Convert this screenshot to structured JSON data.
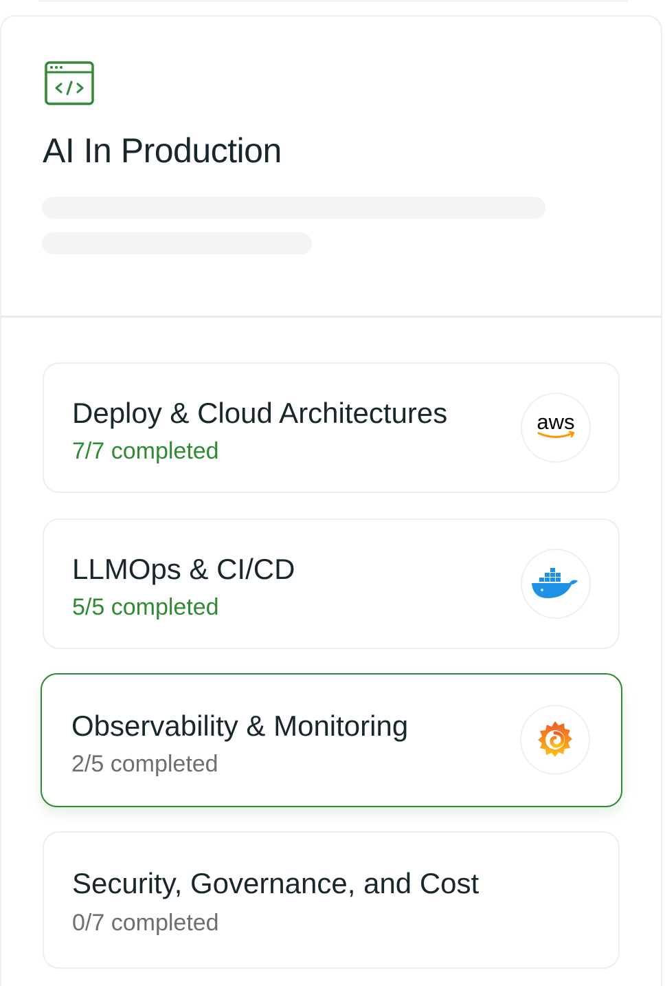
{
  "course": {
    "title": "AI In Production",
    "icon": "code-window-icon",
    "accent_color": "#2e8b33"
  },
  "modules": [
    {
      "title": "Deploy & Cloud Architectures",
      "progress": "7/7 completed",
      "completed": 7,
      "total": 7,
      "status": "done",
      "logo": "aws-logo-icon",
      "logo_text": "aws"
    },
    {
      "title": "LLMOps & CI/CD",
      "progress": "5/5 completed",
      "completed": 5,
      "total": 5,
      "status": "done",
      "logo": "docker-logo-icon"
    },
    {
      "title": "Observability & Monitoring",
      "progress": "2/5 completed",
      "completed": 2,
      "total": 5,
      "status": "active",
      "logo": "grafana-logo-icon"
    },
    {
      "title": "Security, Governance, and Cost",
      "progress": "0/7 completed",
      "completed": 0,
      "total": 7,
      "status": "not-started"
    }
  ]
}
